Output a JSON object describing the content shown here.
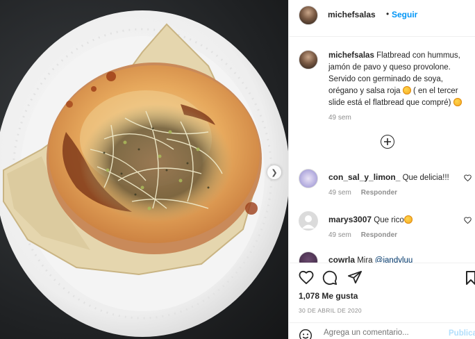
{
  "post": {
    "username": "michefsalas",
    "separator": "•",
    "follow_label": "Seguir",
    "caption_text": "Flatbread con hummus, jamón de pavo y queso provolone. Servido con germinado de soya, orégano y salsa roja",
    "caption_text_2": "( en el tercer slide está el flatbread que compré)",
    "caption_emoji_1": "heart-eyes-emoji",
    "caption_emoji_2": "laughing-emoji",
    "caption_time": "49 sem",
    "likes": "1,078 Me gusta",
    "date": "30 DE ABRIL DE 2020",
    "icons": {
      "like": "heart-icon",
      "comment": "comment-icon",
      "share": "paper-plane-icon",
      "save": "bookmark-icon",
      "load_more": "plus-circle-icon",
      "emoji": "smiley-icon",
      "carousel_next": "chevron-right-icon"
    }
  },
  "comments": [
    {
      "username": "con_sal_y_limon_",
      "text": "Que delicia!!!",
      "time": "49 sem",
      "reply": "Responder"
    },
    {
      "username": "marys3007",
      "text": "Que rico",
      "time": "49 sem",
      "reply": "Responder",
      "emoji": "laughing-emoji"
    },
    {
      "username": "cowrla",
      "text": "Mira",
      "mention": "@iandyluu"
    }
  ],
  "add_comment": {
    "placeholder": "Agrega un comentario...",
    "post_label": "Publicar"
  },
  "colors": {
    "link_blue": "#0095f6",
    "text": "#262626",
    "muted": "#8e8e8e",
    "post_disabled": "#b2dffc"
  }
}
